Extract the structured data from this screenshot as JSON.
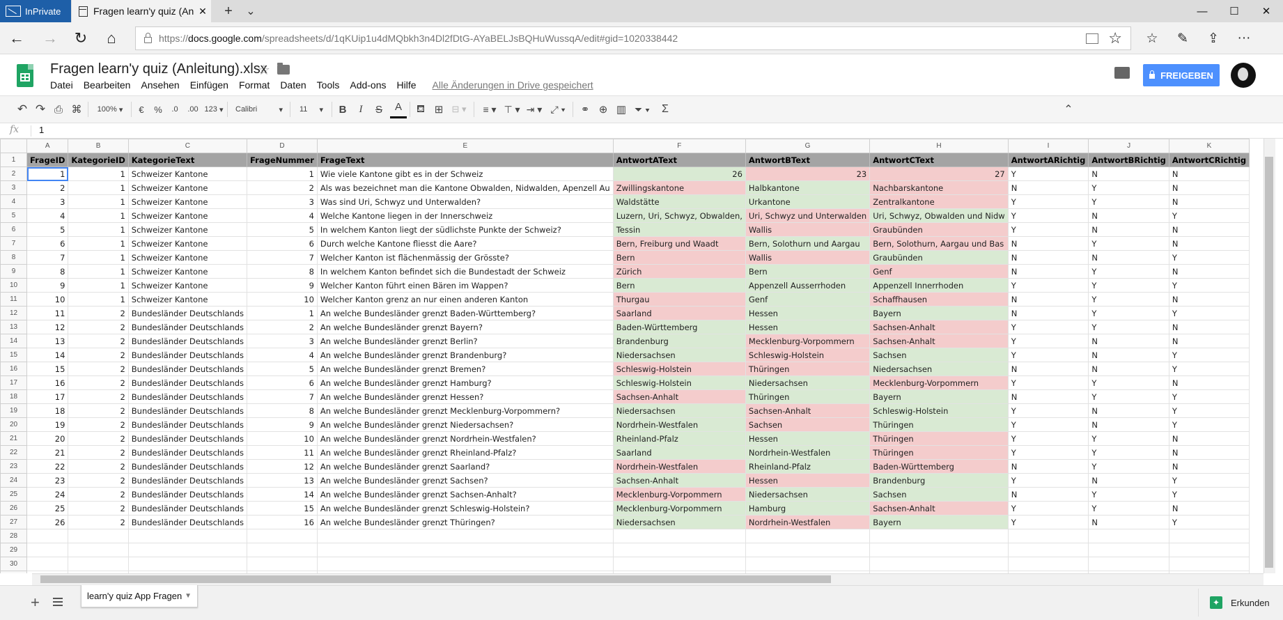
{
  "browser": {
    "inprivate_label": "InPrivate",
    "tab_title": "Fragen learn'y quiz (Anl",
    "tab_close": "✕",
    "new_tab": "+",
    "tab_list": "⌄",
    "win_minimize": "—",
    "win_maximize": "☐",
    "win_close": "✕",
    "url_prefix": "https://",
    "url_host": "docs.google.com",
    "url_path": "/spreadsheets/d/1qKUip1u4dMQbkh3n4Dl2fDtG-AYaBELJsBQHuWussqA/edit#gid=1020338442"
  },
  "doc": {
    "title": "Fragen learn'y quiz (Anleitung).xlsx",
    "menu": [
      "Datei",
      "Bearbeiten",
      "Ansehen",
      "Einfügen",
      "Format",
      "Daten",
      "Tools",
      "Add-ons",
      "Hilfe"
    ],
    "saved_status": "Alle Änderungen in Drive gespeichert",
    "share_label": "FREIGEBEN"
  },
  "toolbar": {
    "zoom": "100%",
    "currency": "€",
    "percent": "%",
    "dec_decrease": ".0",
    "dec_increase": ".00",
    "more_formats": "123",
    "font": "Calibri",
    "font_size": "11",
    "bold": "B",
    "italic": "I",
    "strike": "S",
    "text_color": "A",
    "sum": "Σ"
  },
  "formula_bar": {
    "fx": "fx",
    "value": "1"
  },
  "grid": {
    "columns": [
      "A",
      "B",
      "C",
      "D",
      "E",
      "F",
      "G",
      "H",
      "I",
      "J",
      "K"
    ],
    "header": [
      "FrageID",
      "KategorieID",
      "KategorieText",
      "FrageNummer",
      "FrageText",
      "AntwortAText",
      "AntwortBText",
      "AntwortCText",
      "AntwortARichtig",
      "AntwortBRichtig",
      "AntwortCRichtig"
    ],
    "rows": [
      [
        "1",
        "1",
        "Schweizer Kantone",
        "1",
        "Wie viele Kantone gibt es in der Schweiz",
        "26",
        "23",
        "27",
        "Y",
        "N",
        "N"
      ],
      [
        "2",
        "1",
        "Schweizer Kantone",
        "2",
        "Als was bezeichnet man die Kantone Obwalden, Nidwalden, Apenzell Au",
        "Zwillingskantone",
        "Halbkantone",
        "Nachbarskantone",
        "N",
        "Y",
        "N"
      ],
      [
        "3",
        "1",
        "Schweizer Kantone",
        "3",
        "Was sind Uri, Schwyz und Unterwalden?",
        "Waldstätte",
        "Urkantone",
        "Zentralkantone",
        "Y",
        "Y",
        "N"
      ],
      [
        "4",
        "1",
        "Schweizer Kantone",
        "4",
        "Welche Kantone liegen in der Innerschweiz",
        "Luzern, Uri, Schwyz, Obwalden,",
        "Uri, Schwyz und Unterwalden",
        "Uri, Schwyz, Obwalden und Nidw",
        "Y",
        "N",
        "Y"
      ],
      [
        "5",
        "1",
        "Schweizer Kantone",
        "5",
        "In welchem Kanton liegt der südlichste Punkte der Schweiz?",
        "Tessin",
        "Wallis",
        "Graubünden",
        "Y",
        "N",
        "N"
      ],
      [
        "6",
        "1",
        "Schweizer Kantone",
        "6",
        "Durch welche Kantone fliesst die Aare?",
        "Bern, Freiburg und Waadt",
        "Bern, Solothurn und Aargau",
        "Bern, Solothurn, Aargau und Bas",
        "N",
        "Y",
        "N"
      ],
      [
        "7",
        "1",
        "Schweizer Kantone",
        "7",
        "Welcher Kanton ist flächenmässig der Grösste?",
        "Bern",
        "Wallis",
        "Graubünden",
        "N",
        "N",
        "Y"
      ],
      [
        "8",
        "1",
        "Schweizer Kantone",
        "8",
        "In welchem Kanton befindet sich die Bundestadt der Schweiz",
        "Zürich",
        "Bern",
        "Genf",
        "N",
        "Y",
        "N"
      ],
      [
        "9",
        "1",
        "Schweizer Kantone",
        "9",
        "Welcher Kanton führt einen Bären im Wappen?",
        "Bern",
        "Appenzell Ausserrhoden",
        "Appenzell Innerrhoden",
        "Y",
        "Y",
        "Y"
      ],
      [
        "10",
        "1",
        "Schweizer Kantone",
        "10",
        "Welcher Kanton grenz an nur einen anderen Kanton",
        "Thurgau",
        "Genf",
        "Schaffhausen",
        "N",
        "Y",
        "N"
      ],
      [
        "11",
        "2",
        "Bundesländer Deutschlands",
        "1",
        "An welche Bundesländer grenzt Baden-Württemberg?",
        "Saarland",
        "Hessen",
        "Bayern",
        "N",
        "Y",
        "Y"
      ],
      [
        "12",
        "2",
        "Bundesländer Deutschlands",
        "2",
        "An welche Bundesländer grenzt Bayern?",
        "Baden-Württemberg",
        "Hessen",
        "Sachsen-Anhalt",
        "Y",
        "Y",
        "N"
      ],
      [
        "13",
        "2",
        "Bundesländer Deutschlands",
        "3",
        "An welche Bundesländer grenzt Berlin?",
        "Brandenburg",
        "Mecklenburg-Vorpommern",
        "Sachsen-Anhalt",
        "Y",
        "N",
        "N"
      ],
      [
        "14",
        "2",
        "Bundesländer Deutschlands",
        "4",
        "An welche Bundesländer grenzt Brandenburg?",
        "Niedersachsen",
        "Schleswig-Holstein",
        "Sachsen",
        "Y",
        "N",
        "Y"
      ],
      [
        "15",
        "2",
        "Bundesländer Deutschlands",
        "5",
        "An welche Bundesländer grenzt Bremen?",
        "Schleswig-Holstein",
        "Thüringen",
        "Niedersachsen",
        "N",
        "N",
        "Y"
      ],
      [
        "16",
        "2",
        "Bundesländer Deutschlands",
        "6",
        "An welche Bundesländer grenzt Hamburg?",
        "Schleswig-Holstein",
        "Niedersachsen",
        "Mecklenburg-Vorpommern",
        "Y",
        "Y",
        "N"
      ],
      [
        "17",
        "2",
        "Bundesländer Deutschlands",
        "7",
        "An welche Bundesländer grenzt Hessen?",
        "Sachsen-Anhalt",
        "Thüringen",
        "Bayern",
        "N",
        "Y",
        "Y"
      ],
      [
        "18",
        "2",
        "Bundesländer Deutschlands",
        "8",
        "An welche Bundesländer grenzt Mecklenburg-Vorpommern?",
        "Niedersachsen",
        "Sachsen-Anhalt",
        "Schleswig-Holstein",
        "Y",
        "N",
        "Y"
      ],
      [
        "19",
        "2",
        "Bundesländer Deutschlands",
        "9",
        "An welche Bundesländer grenzt Niedersachsen?",
        "Nordrhein-Westfalen",
        "Sachsen",
        "Thüringen",
        "Y",
        "N",
        "Y"
      ],
      [
        "20",
        "2",
        "Bundesländer Deutschlands",
        "10",
        "An welche Bundesländer grenzt Nordrhein-Westfalen?",
        "Rheinland-Pfalz",
        "Hessen",
        "Thüringen",
        "Y",
        "Y",
        "N"
      ],
      [
        "21",
        "2",
        "Bundesländer Deutschlands",
        "11",
        "An welche Bundesländer grenzt Rheinland-Pfalz?",
        "Saarland",
        "Nordrhein-Westfalen",
        "Thüringen",
        "Y",
        "Y",
        "N"
      ],
      [
        "22",
        "2",
        "Bundesländer Deutschlands",
        "12",
        "An welche Bundesländer grenzt Saarland?",
        "Nordrhein-Westfalen",
        "Rheinland-Pfalz",
        "Baden-Württemberg",
        "N",
        "Y",
        "N"
      ],
      [
        "23",
        "2",
        "Bundesländer Deutschlands",
        "13",
        "An welche Bundesländer grenzt Sachsen?",
        "Sachsen-Anhalt",
        "Hessen",
        "Brandenburg",
        "Y",
        "N",
        "Y"
      ],
      [
        "24",
        "2",
        "Bundesländer Deutschlands",
        "14",
        "An welche Bundesländer grenzt Sachsen-Anhalt?",
        "Mecklenburg-Vorpommern",
        "Niedersachsen",
        "Sachsen",
        "N",
        "Y",
        "Y"
      ],
      [
        "25",
        "2",
        "Bundesländer Deutschlands",
        "15",
        "An welche Bundesländer grenzt Schleswig-Holstein?",
        "Mecklenburg-Vorpommern",
        "Hamburg",
        "Sachsen-Anhalt",
        "Y",
        "Y",
        "N"
      ],
      [
        "26",
        "2",
        "Bundesländer Deutschlands",
        "16",
        "An welche Bundesländer grenzt Thüringen?",
        "Niedersachsen",
        "Nordrhein-Westfalen",
        "Bayern",
        "Y",
        "N",
        "Y"
      ]
    ],
    "empty_rows": [
      "28",
      "29",
      "30",
      "31"
    ]
  },
  "sheets": {
    "add": "+",
    "active_tab": "learn'y quiz App Fragen",
    "explore_label": "Erkunden"
  },
  "colors": {
    "correct": "#d9ead3",
    "wrong": "#f4cccc",
    "header_row": "#a4a4a4",
    "share_button": "#4d90fe",
    "sheets_green": "#1fa463",
    "inprivate": "#1e5fa8"
  }
}
